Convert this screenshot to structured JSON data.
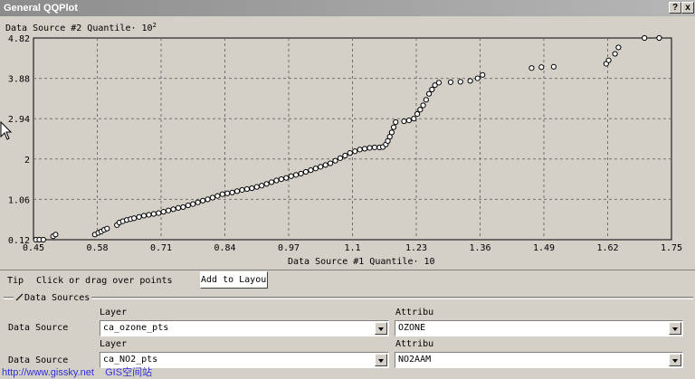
{
  "window": {
    "title": "General QQPlot",
    "help_glyph": "?",
    "close_glyph": "x"
  },
  "plot": {
    "y_title": "Data Source #2 Quantile· 10",
    "y_exp": "2",
    "x_title": "Data Source #1 Quantile· 10"
  },
  "chart_data": {
    "type": "scatter",
    "xlabel": "Data Source #1 Quantile· 10",
    "ylabel": "Data Source #2 Quantile· 10^2",
    "xlim": [
      0.45,
      1.75
    ],
    "ylim": [
      0.12,
      4.82
    ],
    "x_ticks": [
      "0.45",
      "0.58",
      "0.71",
      "0.84",
      "0.97",
      "1.1",
      "1.23",
      "1.36",
      "1.49",
      "1.62",
      "1.75"
    ],
    "y_ticks": [
      "0.12",
      "1.06",
      "2",
      "2.94",
      "3.88",
      "4.82"
    ],
    "grid": true,
    "points": [
      [
        0.455,
        0.12
      ],
      [
        0.462,
        0.12
      ],
      [
        0.47,
        0.12
      ],
      [
        0.49,
        0.2
      ],
      [
        0.495,
        0.24
      ],
      [
        0.575,
        0.24
      ],
      [
        0.582,
        0.28
      ],
      [
        0.588,
        0.31
      ],
      [
        0.594,
        0.35
      ],
      [
        0.6,
        0.38
      ],
      [
        0.62,
        0.46
      ],
      [
        0.625,
        0.52
      ],
      [
        0.632,
        0.55
      ],
      [
        0.64,
        0.58
      ],
      [
        0.648,
        0.6
      ],
      [
        0.655,
        0.62
      ],
      [
        0.665,
        0.65
      ],
      [
        0.675,
        0.68
      ],
      [
        0.685,
        0.7
      ],
      [
        0.695,
        0.72
      ],
      [
        0.705,
        0.74
      ],
      [
        0.715,
        0.77
      ],
      [
        0.725,
        0.8
      ],
      [
        0.735,
        0.83
      ],
      [
        0.745,
        0.86
      ],
      [
        0.755,
        0.88
      ],
      [
        0.765,
        0.92
      ],
      [
        0.775,
        0.95
      ],
      [
        0.785,
        0.99
      ],
      [
        0.795,
        1.03
      ],
      [
        0.805,
        1.06
      ],
      [
        0.815,
        1.1
      ],
      [
        0.825,
        1.14
      ],
      [
        0.835,
        1.18
      ],
      [
        0.845,
        1.2
      ],
      [
        0.855,
        1.22
      ],
      [
        0.865,
        1.25
      ],
      [
        0.875,
        1.28
      ],
      [
        0.885,
        1.3
      ],
      [
        0.895,
        1.32
      ],
      [
        0.905,
        1.35
      ],
      [
        0.915,
        1.38
      ],
      [
        0.925,
        1.42
      ],
      [
        0.935,
        1.46
      ],
      [
        0.945,
        1.5
      ],
      [
        0.955,
        1.53
      ],
      [
        0.965,
        1.56
      ],
      [
        0.975,
        1.6
      ],
      [
        0.985,
        1.63
      ],
      [
        0.995,
        1.66
      ],
      [
        1.005,
        1.7
      ],
      [
        1.015,
        1.74
      ],
      [
        1.025,
        1.78
      ],
      [
        1.035,
        1.82
      ],
      [
        1.045,
        1.86
      ],
      [
        1.055,
        1.9
      ],
      [
        1.065,
        1.96
      ],
      [
        1.075,
        2.02
      ],
      [
        1.085,
        2.08
      ],
      [
        1.095,
        2.14
      ],
      [
        1.105,
        2.18
      ],
      [
        1.115,
        2.22
      ],
      [
        1.125,
        2.24
      ],
      [
        1.135,
        2.26
      ],
      [
        1.145,
        2.27
      ],
      [
        1.155,
        2.27
      ],
      [
        1.162,
        2.28
      ],
      [
        1.168,
        2.34
      ],
      [
        1.172,
        2.42
      ],
      [
        1.176,
        2.52
      ],
      [
        1.18,
        2.62
      ],
      [
        1.184,
        2.74
      ],
      [
        1.188,
        2.86
      ],
      [
        1.205,
        2.88
      ],
      [
        1.215,
        2.9
      ],
      [
        1.225,
        2.94
      ],
      [
        1.232,
        3.05
      ],
      [
        1.238,
        3.15
      ],
      [
        1.244,
        3.25
      ],
      [
        1.25,
        3.38
      ],
      [
        1.256,
        3.52
      ],
      [
        1.262,
        3.62
      ],
      [
        1.268,
        3.72
      ],
      [
        1.276,
        3.78
      ],
      [
        1.3,
        3.79
      ],
      [
        1.32,
        3.8
      ],
      [
        1.34,
        3.82
      ],
      [
        1.355,
        3.88
      ],
      [
        1.365,
        3.96
      ],
      [
        1.465,
        4.12
      ],
      [
        1.485,
        4.14
      ],
      [
        1.51,
        4.15
      ],
      [
        1.617,
        4.22
      ],
      [
        1.622,
        4.3
      ],
      [
        1.635,
        4.45
      ],
      [
        1.642,
        4.6
      ],
      [
        1.695,
        4.82
      ],
      [
        1.725,
        4.82
      ]
    ]
  },
  "controls": {
    "tip_label": "Tip",
    "tip_text": "Click or drag over points",
    "add_button": "Add to Layout",
    "group_label": "Data Sources",
    "sources": [
      {
        "label": "Data Source",
        "layer_header": "Layer",
        "layer_value": "ca_ozone_pts",
        "attr_header": "Attribu",
        "attr_value": "OZONE"
      },
      {
        "label": "Data Source",
        "layer_header": "Layer",
        "layer_value": "ca_NO2_pts",
        "attr_header": "Attribu",
        "attr_value": "NO2AAM"
      }
    ]
  },
  "watermark": {
    "url": "http://www.gissky.net",
    "site": "GIS空间站"
  }
}
